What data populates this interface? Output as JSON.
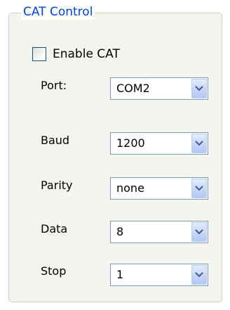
{
  "group": {
    "title": "CAT Control"
  },
  "enable_cat": {
    "label": "Enable CAT",
    "checked": false
  },
  "fields": [
    {
      "label": "Port:",
      "value": "COM2"
    },
    {
      "label": "Baud",
      "value": "1200"
    },
    {
      "label": "Parity",
      "value": "none"
    },
    {
      "label": "Data",
      "value": "8"
    },
    {
      "label": "Stop",
      "value": "1"
    }
  ],
  "icons": {
    "dropdown": "chevron-down-icon"
  },
  "colors": {
    "title": "#0046d5",
    "border": "#7f9db9",
    "button": "#c6d6fa"
  }
}
